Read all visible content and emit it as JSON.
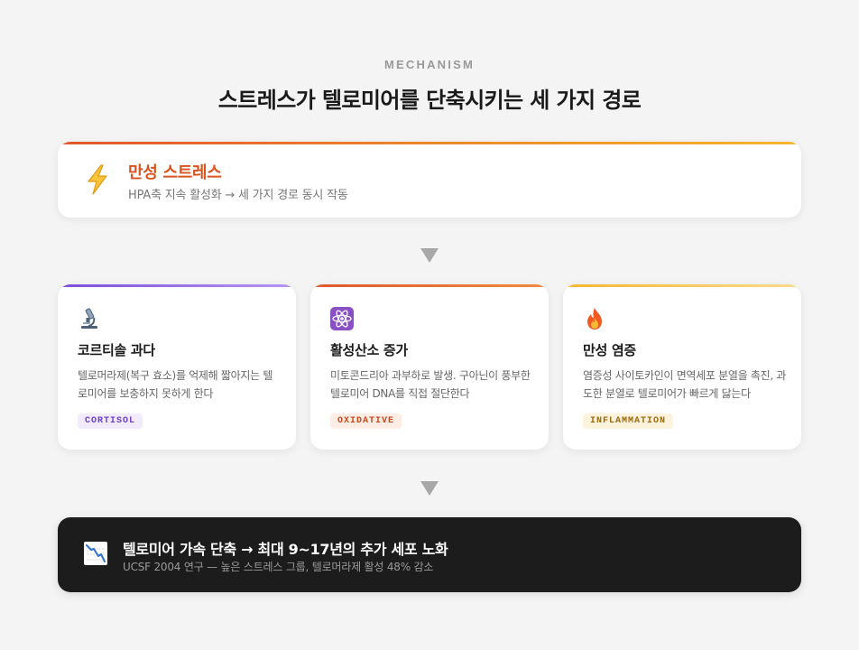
{
  "header": {
    "eyebrow": "MECHANISM",
    "title": "스트레스가 텔로미어를 단축시키는 세 가지 경로"
  },
  "source": {
    "icon": "lightning-icon",
    "title": "만성 스트레스",
    "subtitle": "HPA축 지속 활성화 → 세 가지 경로 동시 작동",
    "accent": "#d9531e"
  },
  "mechanisms": [
    {
      "icon": "microscope-icon",
      "title": "코르티솔 과다",
      "description": "텔로머라제(복구 효소)를 억제해 짧아지는 텔로미어를 보충하지 못하게 한다",
      "tag": "CORTISOL",
      "accent": "#7c4ddb"
    },
    {
      "icon": "atom-icon",
      "title": "활성산소 증가",
      "description": "미토콘드리아 과부하로 발생. 구아닌이 풍부한 텔로미어 DNA를 직접 절단한다",
      "tag": "OXIDATIVE",
      "accent": "#e0572b"
    },
    {
      "icon": "fire-icon",
      "title": "만성 염증",
      "description": "염증성 사이토카인이 면역세포 분열을 촉진, 과도한 분열로 텔로미어가 빠르게 닳는다",
      "tag": "INFLAMMATION",
      "accent": "#f5b62f"
    }
  ],
  "result": {
    "icon": "chart-decreasing-icon",
    "title": "텔로미어 가속 단축 → 최대 9~17년의 추가 세포 노화",
    "subtitle": "UCSF 2004 연구 — 높은 스트레스 그룹, 텔로머라제 활성 48% 감소"
  }
}
